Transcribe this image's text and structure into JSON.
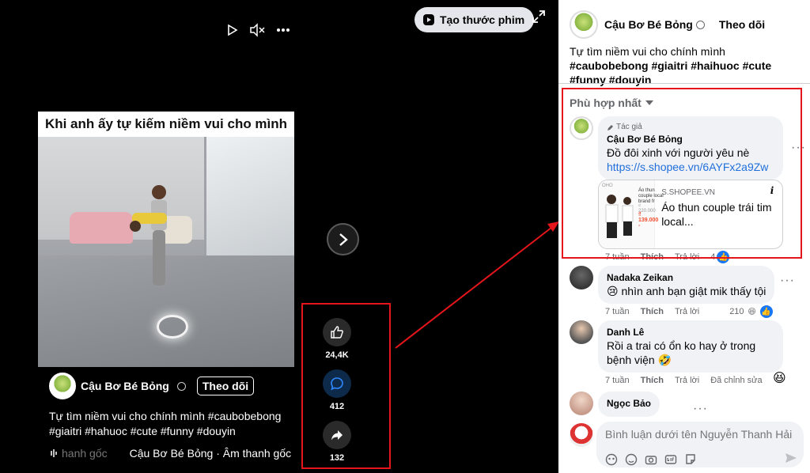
{
  "video": {
    "create_button_label": "Tạo thước phim",
    "overlay_title": "Khi anh ấy tự kiếm niềm vui cho mình",
    "author_name": "Cậu Bơ Bé Bỏng",
    "follow_label": "Theo dõi",
    "description": "Tự tìm niềm vui cho chính mình #caubobebong #giaitri #hahuoc #cute #funny #douyin",
    "audio_faded": "hanh gốc",
    "audio_label": "Cậu Bơ Bé Bỏng · Âm thanh gốc"
  },
  "actions": {
    "likes": "24,4K",
    "comments": "412",
    "shares": "132"
  },
  "post": {
    "author_name": "Cậu Bơ Bé Bỏng",
    "follow_label": "Theo dõi",
    "description_plain": "Tự tìm niềm vui cho chính mình ",
    "description_tags": "#caubobebong #giaitri #haihuoc #cute #funny #douyin"
  },
  "comments_sort": "Phù hợp nhất",
  "comments": [
    {
      "author_tag": "Tác giả",
      "name": "Cậu Bơ Bé Bỏng",
      "text": "Đồ đôi xinh với người yêu nè",
      "link": "https://s.shopee.vn/6AYFx2a9Zw",
      "time": "7 tuần",
      "like": "Thích",
      "reply": "Trả lời",
      "reactions": "4"
    },
    {
      "name": "Nadaka Zeikan",
      "text": "nhìn anh bạn giật mik thấy tội",
      "time": "7 tuần",
      "like": "Thích",
      "reply": "Trả lời",
      "reactions": "210"
    },
    {
      "name": "Danh Lê",
      "text": "Rồi a trai có ổn ko hay ở trong bệnh viện",
      "time": "7 tuần",
      "like": "Thích",
      "reply": "Trả lời",
      "edited": "Đã chỉnh sửa"
    },
    {
      "name": "Ngọc Bảo"
    }
  ],
  "link_card": {
    "domain": "S.SHOPEE.VN",
    "title": "Áo thun couple trái tim local...",
    "thumb_text": "Áo thun couple local brand fr",
    "thumb_price_old": "₫ 220.000",
    "thumb_price": "₫ 139.000 -",
    "thumb_brand": "OHO"
  },
  "comment_input": {
    "placeholder": "Bình luận dưới tên Nguyễn Thanh Hải"
  },
  "colors": {
    "highlight_red": "#e4151b",
    "link_blue": "#216fdb",
    "bubble_bg": "#f0f2f5"
  }
}
